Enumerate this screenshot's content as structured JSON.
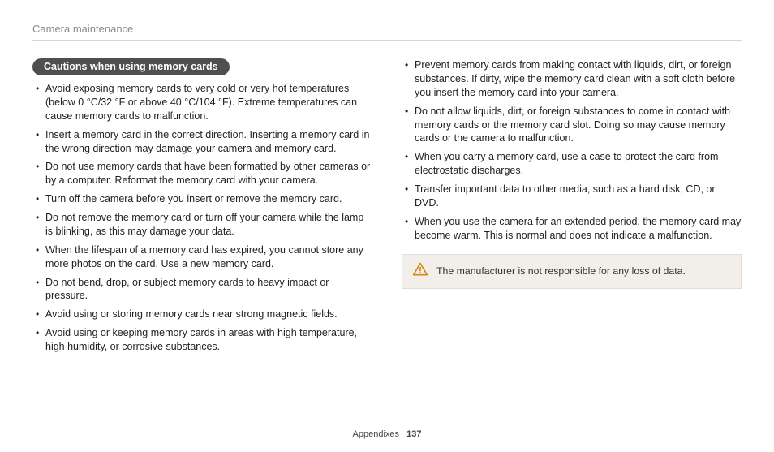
{
  "header": {
    "section": "Camera maintenance"
  },
  "badge": {
    "label": "Cautions when using memory cards"
  },
  "left_bullets": [
    "Avoid exposing memory cards to very cold or very hot temperatures (below 0 °C/32 °F or above 40 °C/104 °F). Extreme temperatures can cause memory cards to malfunction.",
    "Insert a memory card in the correct direction. Inserting a memory card in the wrong direction may damage your camera and memory card.",
    "Do not use memory cards that have been formatted by other cameras or by a computer. Reformat the memory card with your camera.",
    "Turn off the camera before you insert or remove the memory card.",
    "Do not remove the memory card or turn off your camera while the lamp is blinking, as this may damage your data.",
    "When the lifespan of a memory card has expired, you cannot store any more photos on the card. Use a new memory card.",
    "Do not bend, drop, or subject memory cards to heavy impact or pressure.",
    "Avoid using or storing memory cards near strong magnetic fields.",
    "Avoid using or keeping memory cards in areas with high temperature, high humidity, or corrosive substances."
  ],
  "right_bullets": [
    "Prevent memory cards from making contact with liquids, dirt, or foreign substances. If dirty, wipe the memory card clean with a soft cloth before you insert the memory card into your camera.",
    "Do not allow liquids, dirt, or foreign substances to come in contact with memory cards or the memory card slot. Doing so may cause memory cards or the camera to malfunction.",
    "When you carry a memory card, use a case to protect the card from electrostatic discharges.",
    "Transfer important data to other media, such as a hard disk, CD, or DVD.",
    "When you use the camera for an extended period, the memory card may become warm. This is normal and does not indicate a malfunction."
  ],
  "warning": {
    "text": "The manufacturer is not responsible for any loss of data."
  },
  "footer": {
    "label": "Appendixes",
    "page": "137"
  }
}
